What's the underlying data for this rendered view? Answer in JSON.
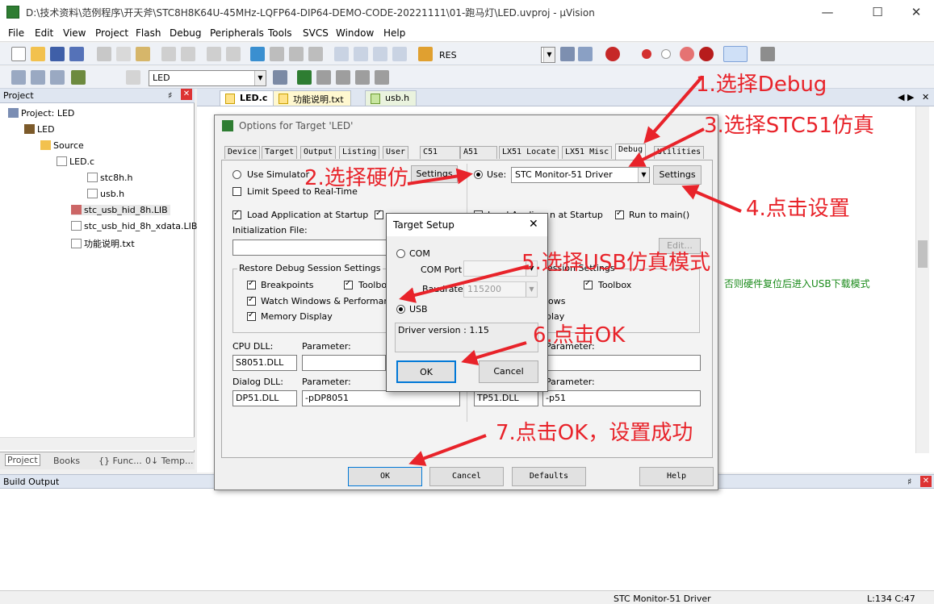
{
  "window": {
    "title": "D:\\技术资料\\范例程序\\开天斧\\STC8H8K64U-45MHz-LQFP64-DIP64-DEMO-CODE-20221111\\01-跑马灯\\LED.uvproj - µVision"
  },
  "menu": [
    "File",
    "Edit",
    "View",
    "Project",
    "Flash",
    "Debug",
    "Peripherals",
    "Tools",
    "SVCS",
    "Window",
    "Help"
  ],
  "toolbar": {
    "build_target_combo": "RES",
    "target_combo": "LED"
  },
  "project_pane": {
    "title": "Project",
    "tree": {
      "project": "Project: LED",
      "target": "LED",
      "group": "Source",
      "file1": "LED.c",
      "inc1": "stc8h.h",
      "inc2": "usb.h",
      "lib1": "stc_usb_hid_8h.LIB",
      "lib2": "stc_usb_hid_8h_xdata.LIB",
      "txt": "功能说明.txt"
    },
    "tabs": [
      "Project",
      "Books",
      "{} Func...",
      "0↓ Temp..."
    ]
  },
  "editor": {
    "tabs": [
      "LED.c",
      "功能说明.txt",
      "usb.h"
    ],
    "visible_text": "否则硬件复位后进入USB下载模式"
  },
  "build_output": {
    "title": "Build Output"
  },
  "statusbar": {
    "driver": "STC Monitor-51 Driver",
    "position": "L:134 C:47"
  },
  "options_dialog": {
    "title": "Options for Target 'LED'",
    "tabs": [
      "Device",
      "Target",
      "Output",
      "Listing",
      "User",
      "C51",
      "A51",
      "LX51 Locate",
      "LX51 Misc",
      "Debug",
      "Utilities"
    ],
    "left": {
      "use_simulator": "Use Simulator",
      "settings": "Settings",
      "limit_speed": "Limit Speed to Real-Time",
      "load_app": "Load Application at Startup",
      "init_file": "Initialization File:",
      "restore_group": "Restore Debug Session Settings",
      "breakpoints": "Breakpoints",
      "toolbox": "Toolbox",
      "watch": "Watch Windows & Performance",
      "memory": "Memory Display",
      "cpu_dll_label": "CPU DLL:",
      "cpu_dll": "S8051.DLL",
      "param_label": "Parameter:",
      "dialog_dll_label": "Dialog DLL:",
      "dialog_dll": "DP51.DLL",
      "dialog_param": "-pDP8051"
    },
    "right": {
      "use": "Use:",
      "driver": "STC Monitor-51 Driver",
      "settings": "Settings",
      "load_app_fragment": "Load Applica",
      "load_app_fragment2": "n at Startup",
      "run_to_main": "Run to main()",
      "edit": "Edit...",
      "restore_fragment": "ession Settings",
      "toolbox": "Toolbox",
      "windows_fragment": "lows",
      "display_fragment": "play",
      "param_label": "Parameter:",
      "dialog_dll": "TP51.DLL",
      "dialog_param": "-p51"
    },
    "buttons": {
      "ok": "OK",
      "cancel": "Cancel",
      "defaults": "Defaults",
      "help": "Help"
    }
  },
  "target_setup": {
    "title": "Target Setup",
    "com": "COM",
    "com_port": "COM Port",
    "baudrate": "Baudrate",
    "baud_value": "115200",
    "usb": "USB",
    "driver_version": "Driver version : 1.15",
    "ok": "OK",
    "cancel": "Cancel"
  },
  "annotations": {
    "a1": "1.选择Debug",
    "a2": "2.选择硬仿",
    "a3": "3.选择STC51仿真",
    "a4": "4.点击设置",
    "a5": "5.选择USB仿真模式",
    "a6": "6.点击OK",
    "a7": "7.点击OK，设置成功"
  },
  "colors": {
    "annotation": "#e8232a",
    "comment_green": "#1a8a1a",
    "pane_header": "#dfe6f1"
  }
}
